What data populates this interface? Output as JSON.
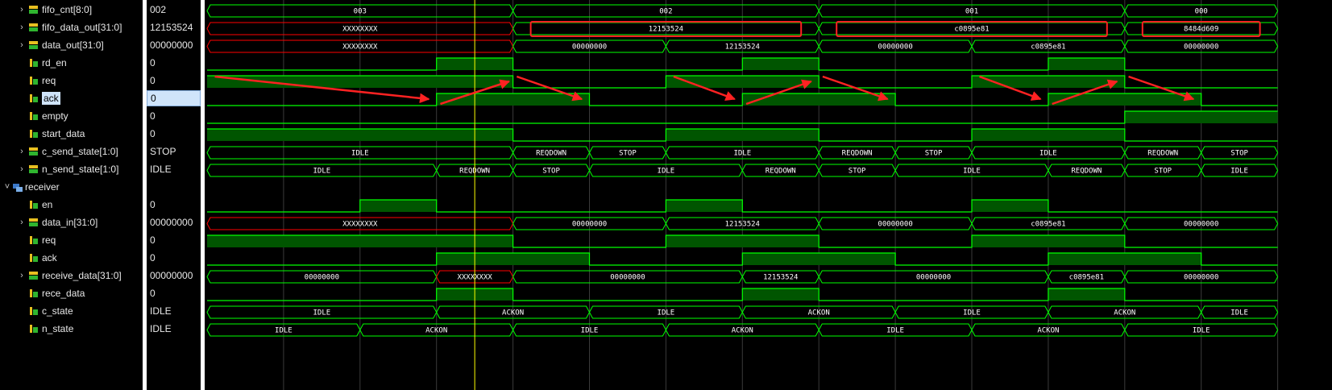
{
  "signals": [
    {
      "name": "fifo_cnt[8:0]",
      "value": "002",
      "icon": "bus-signal-icon",
      "expandable": true,
      "indent": 1
    },
    {
      "name": "fifo_data_out[31:0]",
      "value": "12153524",
      "icon": "bus-signal-icon",
      "expandable": true,
      "indent": 1
    },
    {
      "name": "data_out[31:0]",
      "value": "00000000",
      "icon": "bus-signal-icon",
      "expandable": true,
      "indent": 1
    },
    {
      "name": "rd_en",
      "value": "0",
      "icon": "bit-signal-icon",
      "expandable": false,
      "indent": 1
    },
    {
      "name": "req",
      "value": "0",
      "icon": "bit-signal-icon",
      "expandable": false,
      "indent": 1
    },
    {
      "name": "ack",
      "value": "0",
      "icon": "bit-signal-icon",
      "expandable": false,
      "indent": 1,
      "selected": true
    },
    {
      "name": "empty",
      "value": "0",
      "icon": "bit-signal-icon",
      "expandable": false,
      "indent": 1
    },
    {
      "name": "start_data",
      "value": "0",
      "icon": "bit-signal-icon",
      "expandable": false,
      "indent": 1
    },
    {
      "name": "c_send_state[1:0]",
      "value": "STOP",
      "icon": "bus-signal-icon",
      "expandable": true,
      "indent": 1
    },
    {
      "name": "n_send_state[1:0]",
      "value": "IDLE",
      "icon": "bus-signal-icon",
      "expandable": true,
      "indent": 1
    },
    {
      "name": "receiver",
      "value": "",
      "icon": "scope-icon",
      "expandable": true,
      "expanded": true,
      "indent": 0
    },
    {
      "name": "en",
      "value": "0",
      "icon": "bit-signal-icon",
      "expandable": false,
      "indent": 1
    },
    {
      "name": "data_in[31:0]",
      "value": "00000000",
      "icon": "bus-signal-icon",
      "expandable": true,
      "indent": 1
    },
    {
      "name": "req",
      "value": "0",
      "icon": "bit-signal-icon",
      "expandable": false,
      "indent": 1
    },
    {
      "name": "ack",
      "value": "0",
      "icon": "bit-signal-icon",
      "expandable": false,
      "indent": 1
    },
    {
      "name": "receive_data[31:0]",
      "value": "00000000",
      "icon": "bus-signal-icon",
      "expandable": true,
      "indent": 1
    },
    {
      "name": "rece_data",
      "value": "0",
      "icon": "bit-signal-icon",
      "expandable": false,
      "indent": 1
    },
    {
      "name": "c_state",
      "value": "IDLE",
      "icon": "bit-signal-icon",
      "expandable": false,
      "indent": 1
    },
    {
      "name": "n_state",
      "value": "IDLE",
      "icon": "bit-signal-icon",
      "expandable": false,
      "indent": 1
    }
  ],
  "cursor": {
    "time_index": 3.5
  },
  "waves": [
    {
      "type": "bus",
      "segments": [
        [
          0,
          4,
          "003"
        ],
        [
          4,
          8,
          "002"
        ],
        [
          8,
          12,
          "001"
        ],
        [
          12,
          14,
          "000"
        ]
      ]
    },
    {
      "type": "bus",
      "segments": [
        [
          0,
          4,
          "XXXXXXXX",
          "x"
        ],
        [
          4,
          8,
          "12153524"
        ],
        [
          8,
          12,
          "c0895e81"
        ],
        [
          12,
          14,
          "8484d609"
        ]
      ]
    },
    {
      "type": "bus",
      "segments": [
        [
          0,
          4,
          "XXXXXXXX",
          "x"
        ],
        [
          4,
          6,
          "00000000"
        ],
        [
          6,
          8,
          "12153524"
        ],
        [
          8,
          10,
          "00000000"
        ],
        [
          10,
          12,
          "c0895e81"
        ],
        [
          12,
          14,
          "00000000"
        ]
      ]
    },
    {
      "type": "bit",
      "high": [
        [
          3,
          4
        ],
        [
          7,
          8
        ],
        [
          11,
          12
        ]
      ]
    },
    {
      "type": "bit",
      "high": [
        [
          0,
          4
        ],
        [
          6,
          8
        ],
        [
          10,
          12
        ]
      ]
    },
    {
      "type": "bit",
      "high": [
        [
          3,
          5
        ],
        [
          7,
          9
        ],
        [
          11,
          13
        ]
      ]
    },
    {
      "type": "bit",
      "high": [
        [
          12,
          14
        ]
      ]
    },
    {
      "type": "bit",
      "high": [
        [
          0,
          4
        ],
        [
          6,
          8
        ],
        [
          10,
          12
        ]
      ]
    },
    {
      "type": "bus",
      "segments": [
        [
          0,
          4,
          "IDLE"
        ],
        [
          4,
          5,
          "REQDOWN"
        ],
        [
          5,
          6,
          "STOP"
        ],
        [
          6,
          8,
          "IDLE"
        ],
        [
          8,
          9,
          "REQDOWN"
        ],
        [
          9,
          10,
          "STOP"
        ],
        [
          10,
          12,
          "IDLE"
        ],
        [
          12,
          13,
          "REQDOWN"
        ],
        [
          13,
          14,
          "STOP"
        ]
      ]
    },
    {
      "type": "bus",
      "segments": [
        [
          0,
          3,
          "IDLE"
        ],
        [
          3,
          4,
          "REQDOWN"
        ],
        [
          4,
          5,
          "STOP"
        ],
        [
          5,
          7,
          "IDLE"
        ],
        [
          7,
          8,
          "REQDOWN"
        ],
        [
          8,
          9,
          "STOP"
        ],
        [
          9,
          11,
          "IDLE"
        ],
        [
          11,
          12,
          "REQDOWN"
        ],
        [
          12,
          13,
          "STOP"
        ],
        [
          13,
          14,
          "IDLE"
        ]
      ]
    },
    {
      "type": "none"
    },
    {
      "type": "bit",
      "high": [
        [
          2,
          3
        ],
        [
          6,
          7
        ],
        [
          10,
          11
        ]
      ]
    },
    {
      "type": "bus",
      "segments": [
        [
          0,
          4,
          "XXXXXXXX",
          "x"
        ],
        [
          4,
          6,
          "00000000"
        ],
        [
          6,
          8,
          "12153524"
        ],
        [
          8,
          10,
          "00000000"
        ],
        [
          10,
          12,
          "c0895e81"
        ],
        [
          12,
          14,
          "00000000"
        ]
      ]
    },
    {
      "type": "bit",
      "high": [
        [
          0,
          4
        ],
        [
          6,
          8
        ],
        [
          10,
          12
        ]
      ]
    },
    {
      "type": "bit",
      "high": [
        [
          3,
          5
        ],
        [
          7,
          9
        ],
        [
          11,
          13
        ]
      ]
    },
    {
      "type": "bus",
      "segments": [
        [
          0,
          3,
          "00000000"
        ],
        [
          3,
          4,
          "XXXXXXXX",
          "x"
        ],
        [
          4,
          7,
          "00000000"
        ],
        [
          7,
          8,
          "12153524"
        ],
        [
          8,
          11,
          "00000000"
        ],
        [
          11,
          12,
          "c0895e81"
        ],
        [
          12,
          14,
          "00000000"
        ]
      ]
    },
    {
      "type": "bit",
      "high": [
        [
          3,
          4
        ],
        [
          7,
          8
        ],
        [
          11,
          12
        ]
      ]
    },
    {
      "type": "bus",
      "segments": [
        [
          0,
          3,
          "IDLE"
        ],
        [
          3,
          5,
          "ACKON"
        ],
        [
          5,
          7,
          "IDLE"
        ],
        [
          7,
          9,
          "ACKON"
        ],
        [
          9,
          11,
          "IDLE"
        ],
        [
          11,
          13,
          "ACKON"
        ],
        [
          13,
          14,
          "IDLE"
        ]
      ]
    },
    {
      "type": "bus",
      "segments": [
        [
          0,
          2,
          "IDLE"
        ],
        [
          2,
          4,
          "ACKON"
        ],
        [
          4,
          6,
          "IDLE"
        ],
        [
          6,
          8,
          "ACKON"
        ],
        [
          8,
          10,
          "IDLE"
        ],
        [
          10,
          12,
          "ACKON"
        ],
        [
          12,
          14,
          "IDLE"
        ]
      ]
    }
  ],
  "highlight_boxes": [
    {
      "row": 1,
      "from": 4,
      "to": 8
    },
    {
      "row": 1,
      "from": 8,
      "to": 12
    },
    {
      "row": 1,
      "from": 12,
      "to": 14
    }
  ],
  "arrows": [
    [
      0.1,
      4,
      2.9,
      5
    ],
    [
      3.05,
      5,
      3.95,
      4
    ],
    [
      4.05,
      4,
      4.9,
      5
    ],
    [
      6.1,
      4,
      6.9,
      5
    ],
    [
      7.05,
      5,
      7.9,
      4
    ],
    [
      8.05,
      4,
      8.9,
      5
    ],
    [
      10.1,
      4,
      10.9,
      5
    ],
    [
      11.05,
      5,
      11.9,
      4
    ],
    [
      12.05,
      4,
      12.9,
      5
    ]
  ],
  "colors": {
    "wave_green": "#00ff00",
    "fill_green": "#005500",
    "x_red": "#ff0000",
    "cursor_yellow": "#ffff00",
    "highlight_red": "#ff2222",
    "grid": "#3a3a3a",
    "selection": "#cfe4fa"
  }
}
